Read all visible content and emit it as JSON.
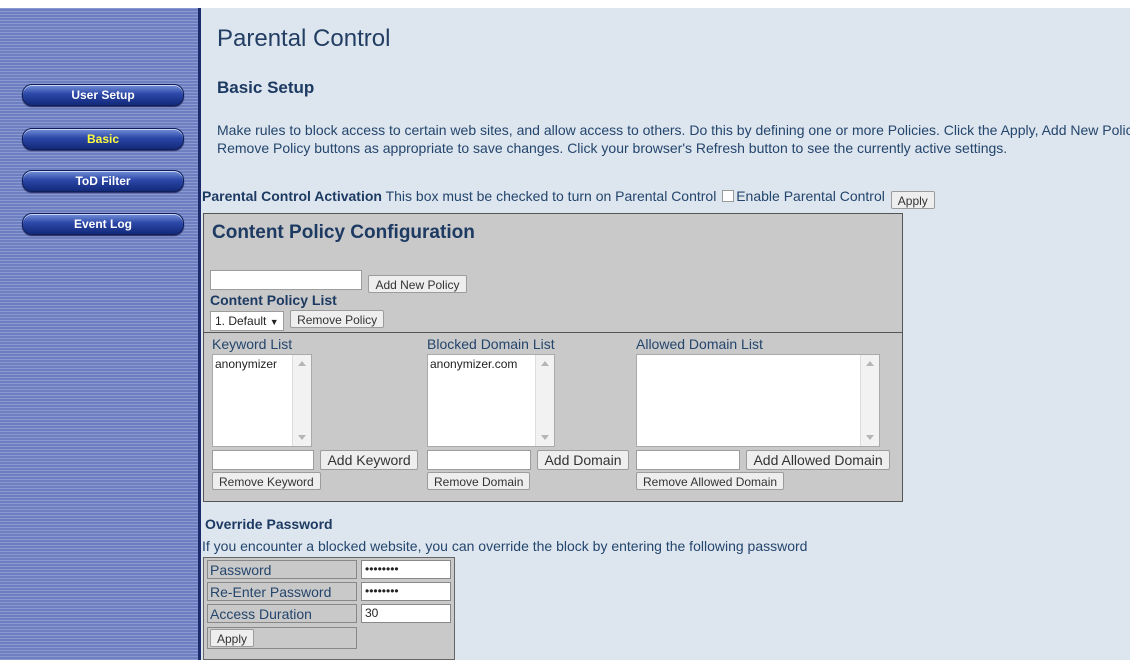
{
  "nav": {
    "items": [
      {
        "label": "User Setup"
      },
      {
        "label": "Basic"
      },
      {
        "label": "ToD Filter"
      },
      {
        "label": "Event Log"
      }
    ]
  },
  "page": {
    "title": "Parental Control",
    "section": "Basic Setup",
    "intro": "Make rules to block access to certain web sites, and allow access to others. Do this by defining one or more Policies. Click the Apply, Add New Policy and Remove Policy buttons as appropriate to save changes. Click your browser's Refresh button to see the currently active settings."
  },
  "activation": {
    "label": "Parental Control Activation",
    "text": "This box must be checked to turn on Parental Control",
    "checkbox_label": "Enable Parental Control",
    "checked": false,
    "apply_label": "Apply"
  },
  "content_policy": {
    "title": "Content Policy Configuration",
    "new_policy_value": "",
    "add_new_policy_label": "Add New Policy",
    "list_label": "Content Policy List",
    "selected_policy": "1. Default",
    "remove_policy_label": "Remove Policy",
    "keyword": {
      "label": "Keyword List",
      "items": [
        "anonymizer"
      ],
      "input_value": "",
      "add_label": "Add Keyword",
      "remove_label": "Remove Keyword"
    },
    "blocked": {
      "label": "Blocked Domain List",
      "items": [
        "anonymizer.com"
      ],
      "input_value": "",
      "add_label": "Add Domain",
      "remove_label": "Remove Domain"
    },
    "allowed": {
      "label": "Allowed Domain List",
      "items": [],
      "input_value": "",
      "add_label": "Add Allowed Domain",
      "remove_label": "Remove Allowed Domain"
    }
  },
  "override": {
    "title": "Override Password",
    "description": "If you encounter a blocked website, you can override the block by entering the following password",
    "password_label": "Password",
    "password_value": "••••••••",
    "reenter_label": "Re-Enter Password",
    "reenter_value": "••••••••",
    "duration_label": "Access Duration",
    "duration_value": "30",
    "apply_label": "Apply"
  },
  "colors": {
    "sidebar": "#6d7fc0",
    "nav_button": "#2b47a8",
    "active_nav_text": "#ffff40",
    "main_bg": "#dde6ef",
    "panel_bg": "#c9c9c9"
  }
}
